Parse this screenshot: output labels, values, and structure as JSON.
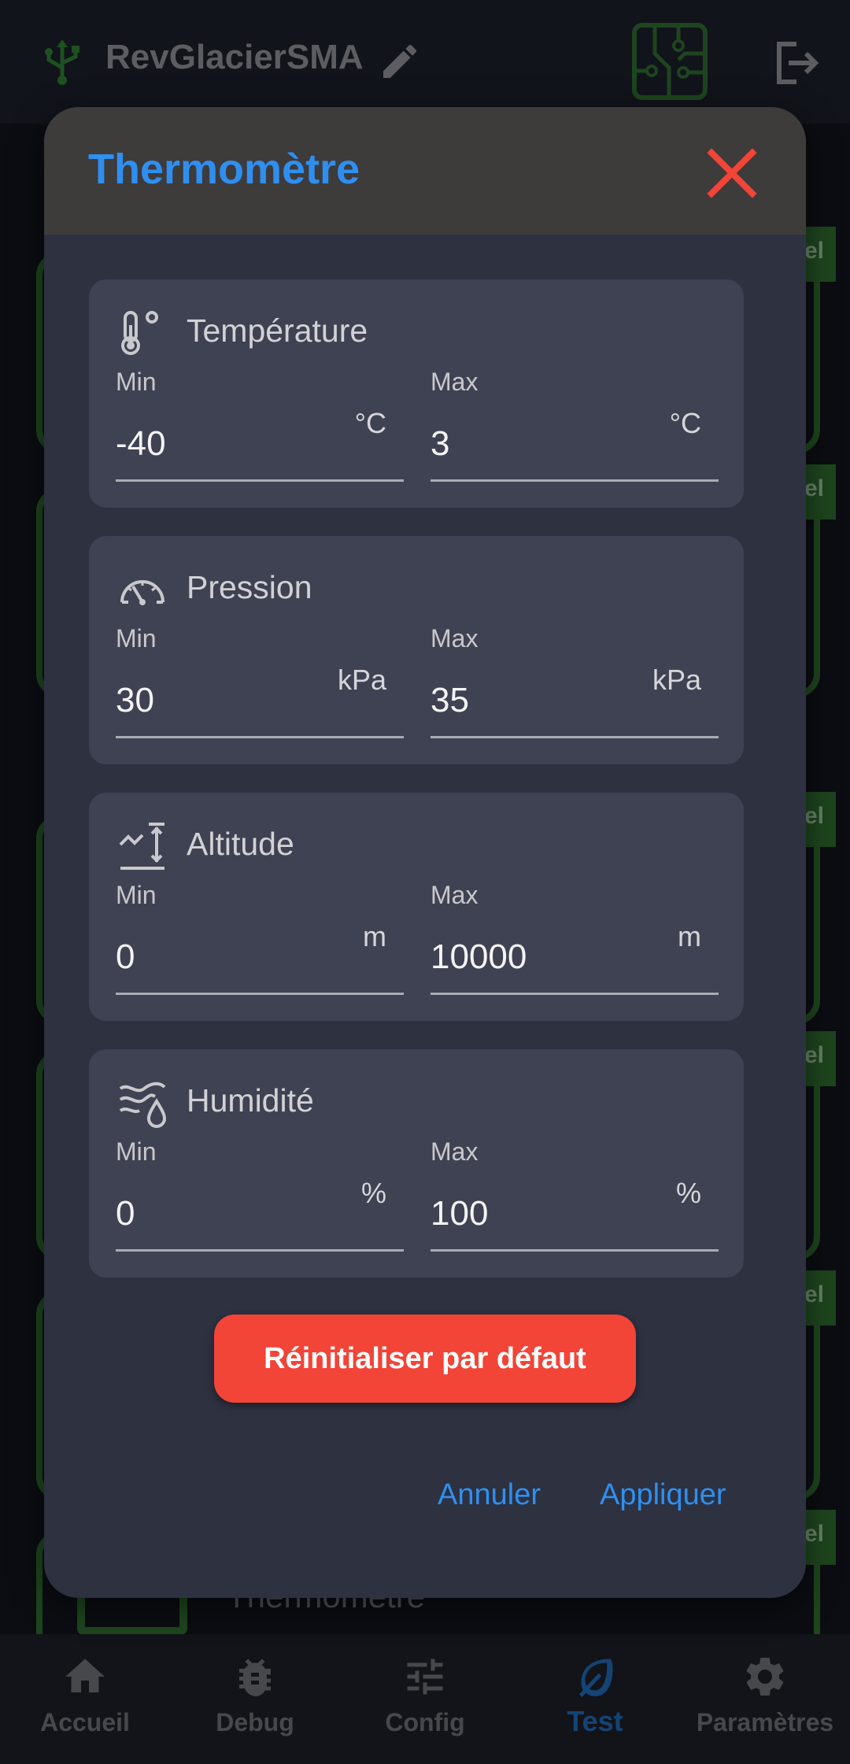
{
  "app_bar": {
    "device_name": "RevGlacierSMA",
    "icons": [
      "usb-icon",
      "edit-icon",
      "circuit-board-icon",
      "logout-icon"
    ]
  },
  "background": {
    "tag_text": "el",
    "visible_title": "Thermomètre"
  },
  "dialog": {
    "title": "Thermomètre",
    "close_icon": "close-icon",
    "sensors": [
      {
        "name": "Température",
        "icon": "thermometer-icon",
        "min_label": "Min",
        "min_value": "-40",
        "max_label": "Max",
        "max_value": "3",
        "unit": "°C"
      },
      {
        "name": "Pression",
        "icon": "gauge-icon",
        "min_label": "Min",
        "min_value": "30",
        "max_label": "Max",
        "max_value": "35",
        "unit": "kPa"
      },
      {
        "name": "Altitude",
        "icon": "altitude-icon",
        "min_label": "Min",
        "min_value": "0",
        "max_label": "Max",
        "max_value": "10000",
        "unit": "m"
      },
      {
        "name": "Humidité",
        "icon": "humidity-icon",
        "min_label": "Min",
        "min_value": "0",
        "max_label": "Max",
        "max_value": "100",
        "unit": "%"
      }
    ],
    "reset_label": "Réinitialiser par défaut",
    "cancel_label": "Annuler",
    "apply_label": "Appliquer"
  },
  "bottom_nav": {
    "active": "Test",
    "items": [
      {
        "label": "Accueil",
        "icon": "home-icon"
      },
      {
        "label": "Debug",
        "icon": "bug-icon"
      },
      {
        "label": "Config",
        "icon": "sliders-icon"
      },
      {
        "label": "Test",
        "icon": "leaf-icon"
      },
      {
        "label": "Paramètres",
        "icon": "gear-icon"
      }
    ]
  },
  "colors": {
    "accent": "#2f8ff0",
    "danger": "#f24437",
    "success_border": "#2f6b2f",
    "dialog_bg": "#2d3140",
    "card_bg": "#3f4252"
  }
}
